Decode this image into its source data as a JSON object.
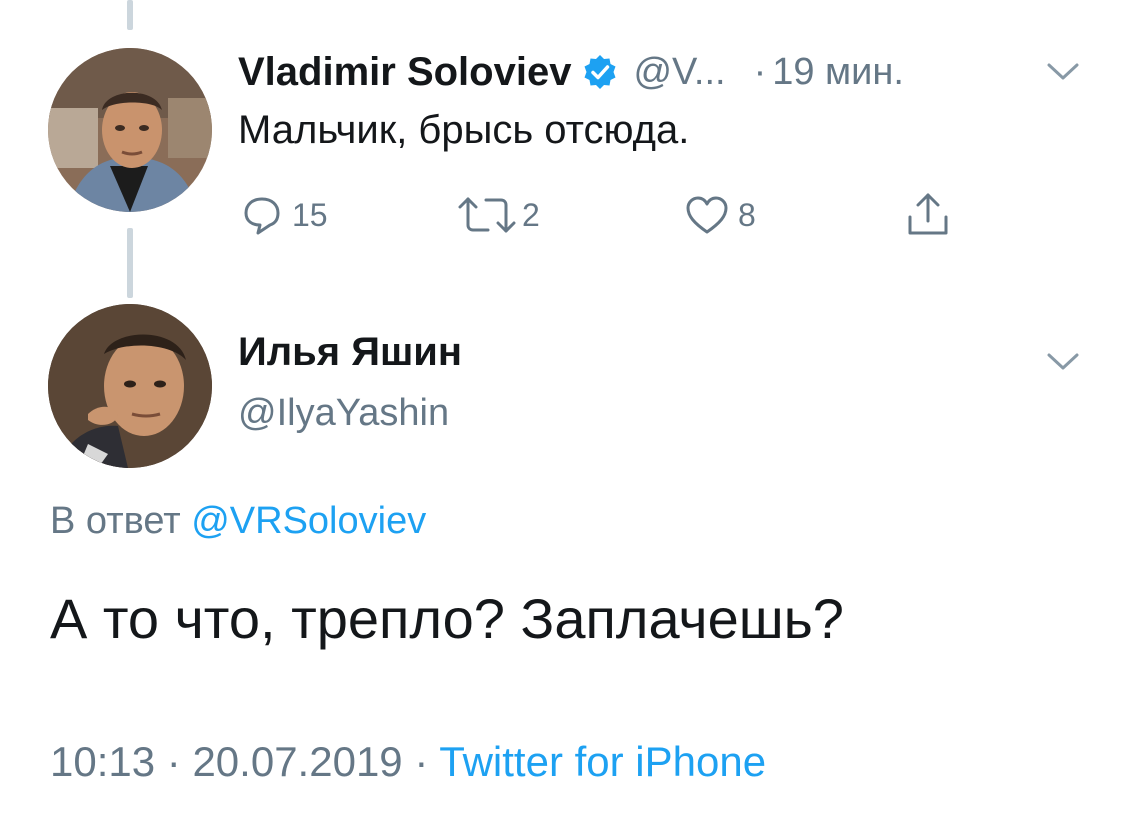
{
  "parent_tweet": {
    "name": "Vladimir Soloviev",
    "handle": "@V...",
    "time": "19 мин.",
    "text": "Мальчик, брысь отсюда.",
    "reply_count": "15",
    "retweet_count": "2",
    "like_count": "8",
    "icons": {
      "reply": "speech-bubble-icon",
      "retweet": "retweet-icon",
      "like": "heart-icon",
      "share": "share-icon",
      "verified": "verified-badge-icon",
      "menu": "chevron-down-icon"
    }
  },
  "reply_tweet": {
    "name": "Илья Яшин",
    "handle": "@IlyaYashin",
    "replying_prefix": "В ответ",
    "replying_to": "@VRSoloviev",
    "text": "А то что, трепло? Заплачешь?",
    "time": "10:13",
    "date": "20.07.2019",
    "source": "Twitter for iPhone",
    "separator": "·"
  },
  "colors": {
    "accent": "#1da1f2",
    "secondary_text": "#657786",
    "primary_text": "#14171a",
    "thread_line": "#ccd6dd"
  }
}
